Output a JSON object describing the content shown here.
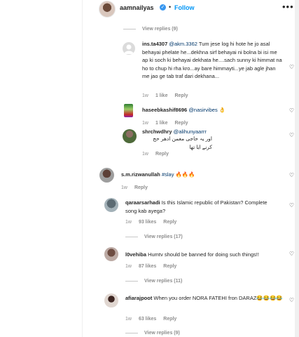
{
  "header": {
    "username": "aamnailyas",
    "follow_label": "Follow",
    "more_label": "•••"
  },
  "replies_1": {
    "label": "View replies (9)"
  },
  "comments": [
    {
      "username": "ins.ta4307",
      "mention": "@akm.3362",
      "text": " Tum jese log hi hote he jo asal behayai phelate he...dekhna sirf behayai ni bolna bi isi me ap ki soch ki behayai dekhata he....sach sunny ki himmat na ho to chup hi rha kro...ay bare himmayti...ye jab agle jhan me jao ge tab traf dari dekhana...",
      "age": "1w",
      "likes": "1 like",
      "reply": "Reply"
    },
    {
      "username": "haseebkashif8696",
      "mention": "@nasirvibes",
      "text": " 👌",
      "age": "1w",
      "likes": "1 like",
      "reply": "Reply"
    },
    {
      "username": "shrchwdhry",
      "mention": "@alihunyaarrr",
      "text": "اور یہ حاجی معمن ادھر حج کرنے ایا تھا",
      "age": "1w",
      "likes": "",
      "reply": "Reply"
    },
    {
      "username": "s.m.rizwanullah",
      "mention": "",
      "text": "#slay 🔥🔥🔥",
      "age": "1w",
      "likes": "",
      "reply": "Reply"
    },
    {
      "username": "qaraarsarhadi",
      "mention": "",
      "text": " Is this Islamic republic of Pakistan? Complete song kab ayega?",
      "age": "1w",
      "likes": "93 likes",
      "reply": "Reply"
    },
    {
      "username": "l0vehiba",
      "mention": "",
      "text": " Humtv should be banned for doing such things!!",
      "age": "1w",
      "likes": "87 likes",
      "reply": "Reply"
    },
    {
      "username": "afiarajpoot",
      "mention": "",
      "text": " When you order NORA FATEHI fron DARAZ😂😂😂😂",
      "age": "1w",
      "likes": "63 likes",
      "reply": "Reply"
    }
  ],
  "replies_2": {
    "label": "View replies (17)"
  },
  "replies_3": {
    "label": "View replies (11)"
  },
  "replies_4": {
    "label": "View replies (9)"
  },
  "colors": {
    "link": "#00376b",
    "follow": "#0095f6",
    "muted": "#8e8e8e",
    "verified": "#3897f0"
  }
}
